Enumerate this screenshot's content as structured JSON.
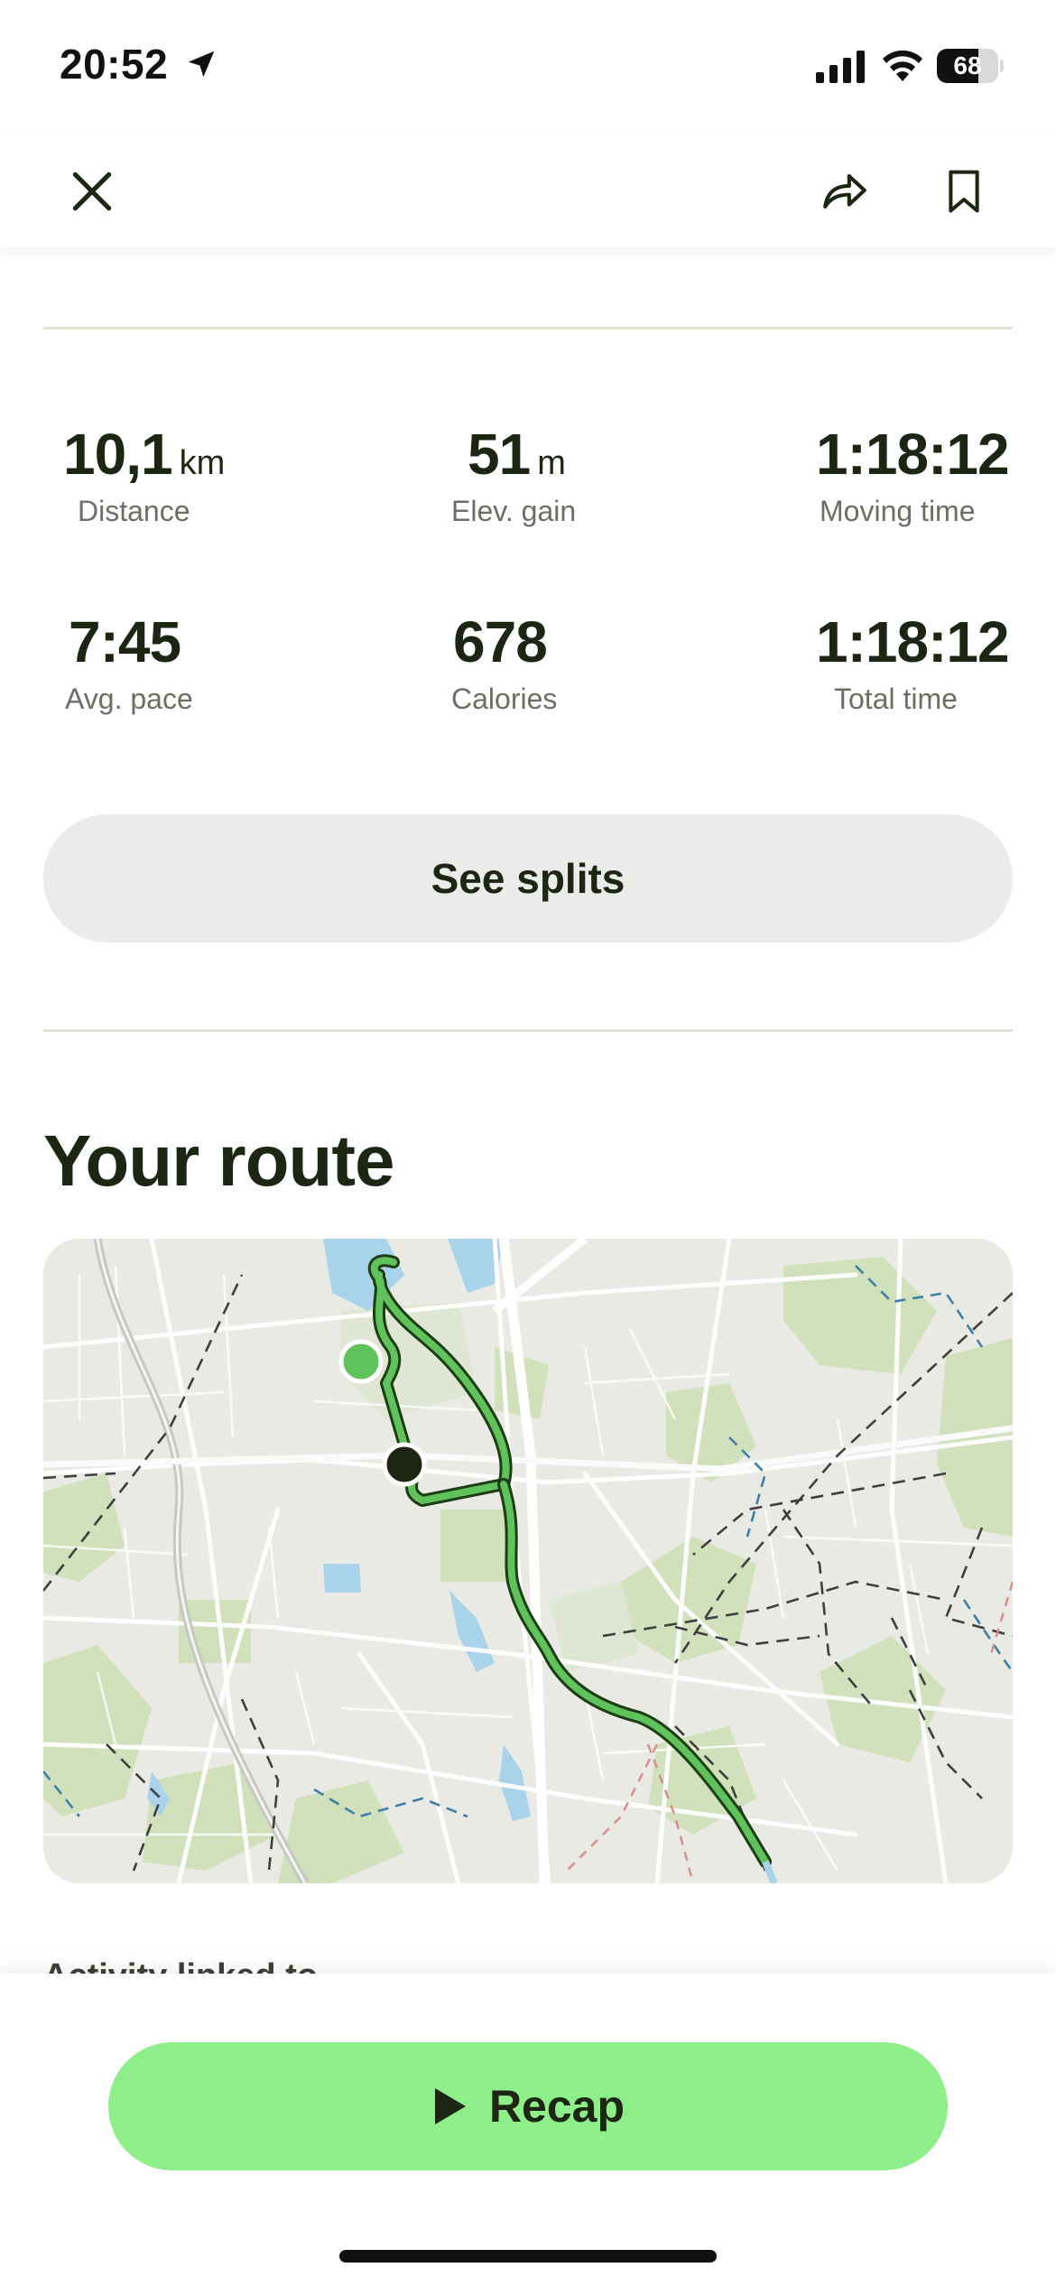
{
  "status_bar": {
    "time": "20:52",
    "battery_level": "68",
    "icons": [
      "location-arrow-icon",
      "cellular-signal-icon",
      "wifi-icon",
      "battery-icon"
    ]
  },
  "header": {
    "icons": [
      "close-icon",
      "share-icon",
      "bookmark-icon"
    ]
  },
  "stats": [
    {
      "value": "10,1",
      "unit": "km",
      "label": "Distance"
    },
    {
      "value": "51",
      "unit": "m",
      "label": "Elev. gain"
    },
    {
      "value": "1:18:12",
      "unit": "",
      "label": "Moving time"
    },
    {
      "value": "7:45",
      "unit": "",
      "label": "Avg. pace"
    },
    {
      "value": "678",
      "unit": "",
      "label": "Calories"
    },
    {
      "value": "1:18:12",
      "unit": "",
      "label": "Total time"
    }
  ],
  "splits_button": "See splits",
  "route_section": {
    "title": "Your route",
    "route_color": "#5fc25a",
    "start_marker_color": "#5fc25a",
    "end_marker_color": "#1c2612"
  },
  "next_section_title": "Activity linked to",
  "recap_button": {
    "label": "Recap",
    "icon": "play-icon",
    "color": "#8dee8a"
  },
  "colors": {
    "text": "#1c2612",
    "secondary_text": "#6a6f66",
    "button_bg": "#ebebe9"
  }
}
